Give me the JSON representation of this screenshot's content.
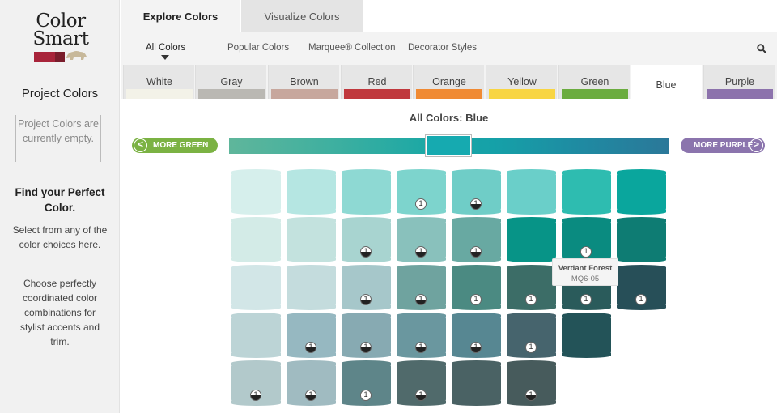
{
  "sidebar": {
    "logo": {
      "line1": "Color",
      "line2": "Smart",
      "colors": [
        "#a8243a",
        "#7a1d2c",
        "#c7b89a"
      ]
    },
    "title": "Project Colors",
    "empty_text": "Project Colors are currently empty.",
    "find_title": "Find your Perfect Color.",
    "para1": "Select from any of the color choices here.",
    "para2": "Choose perfectly coordinated color combinations for stylist accents and trim."
  },
  "tabs": [
    {
      "label": "Explore Colors",
      "active": true
    },
    {
      "label": "Visualize Colors",
      "active": false
    }
  ],
  "subnav": [
    {
      "label": "All Colors",
      "active": true
    },
    {
      "label": "Popular Colors",
      "active": false
    },
    {
      "label": "Marquee® Collection",
      "active": false
    },
    {
      "label": "Decorator Styles",
      "active": false
    }
  ],
  "search_icon": "search-icon",
  "families": [
    {
      "label": "White",
      "color": "#f3f2e8",
      "active": false
    },
    {
      "label": "Gray",
      "color": "#bab8b3",
      "active": false
    },
    {
      "label": "Brown",
      "color": "#c7a79d",
      "active": false
    },
    {
      "label": "Red",
      "color": "#c0383d",
      "active": false
    },
    {
      "label": "Orange",
      "color": "#f08a33",
      "active": false
    },
    {
      "label": "Yellow",
      "color": "#f8d542",
      "active": false
    },
    {
      "label": "Green",
      "color": "#6bac3f",
      "active": false
    },
    {
      "label": "Blue",
      "color": "#ffffff",
      "active": true
    },
    {
      "label": "Purple",
      "color": "#8c72ac",
      "active": false
    }
  ],
  "heading": "All Colors: Blue",
  "more_green": "MORE GREEN",
  "more_purple": "MORE PURPLE",
  "chips": [
    [
      {
        "color": "#d6efec",
        "badge": ""
      },
      {
        "color": "#b5e6e2",
        "badge": ""
      },
      {
        "color": "#8ed9d3",
        "badge": ""
      },
      {
        "color": "#7dd4cd",
        "badge": "1"
      },
      {
        "color": "#6fcdc7",
        "badge": "half"
      },
      {
        "color": "#6acfc9",
        "badge": ""
      },
      {
        "color": "#2ebcb0",
        "badge": ""
      },
      {
        "color": "#0aa69d",
        "badge": ""
      }
    ],
    [
      {
        "color": "#d3ebe7",
        "badge": ""
      },
      {
        "color": "#c3e2de",
        "badge": ""
      },
      {
        "color": "#a8d4d0",
        "badge": "half"
      },
      {
        "color": "#89c1bc",
        "badge": "half"
      },
      {
        "color": "#68a9a2",
        "badge": "half"
      },
      {
        "color": "#079487",
        "badge": ""
      },
      {
        "color": "#0a8b80",
        "badge": "1"
      },
      {
        "color": "#0e7c73",
        "badge": ""
      }
    ],
    [
      {
        "color": "#d2e6e7",
        "badge": ""
      },
      {
        "color": "#c4dcdd",
        "badge": ""
      },
      {
        "color": "#a6c7ca",
        "badge": "half"
      },
      {
        "color": "#6fa39f",
        "badge": "half"
      },
      {
        "color": "#4b8a82",
        "badge": "1"
      },
      {
        "color": "#3c6d67",
        "badge": "1"
      },
      {
        "color": "#2a5b5b",
        "badge": "1"
      },
      {
        "color": "#274f58",
        "badge": "1"
      }
    ],
    [
      {
        "color": "#bcd4d6",
        "badge": ""
      },
      {
        "color": "#96b8c1",
        "badge": "half"
      },
      {
        "color": "#87aab2",
        "badge": "half"
      },
      {
        "color": "#6a979f",
        "badge": "half"
      },
      {
        "color": "#578792",
        "badge": "half"
      },
      {
        "color": "#46646d",
        "badge": "1"
      },
      {
        "color": "#235358",
        "badge": ""
      }
    ],
    [
      {
        "color": "#b2c9cb",
        "badge": "half"
      },
      {
        "color": "#a0bbc1",
        "badge": "half"
      },
      {
        "color": "#5e8589",
        "badge": "1"
      },
      {
        "color": "#506a6b",
        "badge": "half"
      },
      {
        "color": "#4a6264",
        "badge": ""
      },
      {
        "color": "#475b5c",
        "badge": "half"
      }
    ]
  ],
  "tooltip": {
    "name": "Verdant Forest",
    "code": "MQ6-05"
  }
}
